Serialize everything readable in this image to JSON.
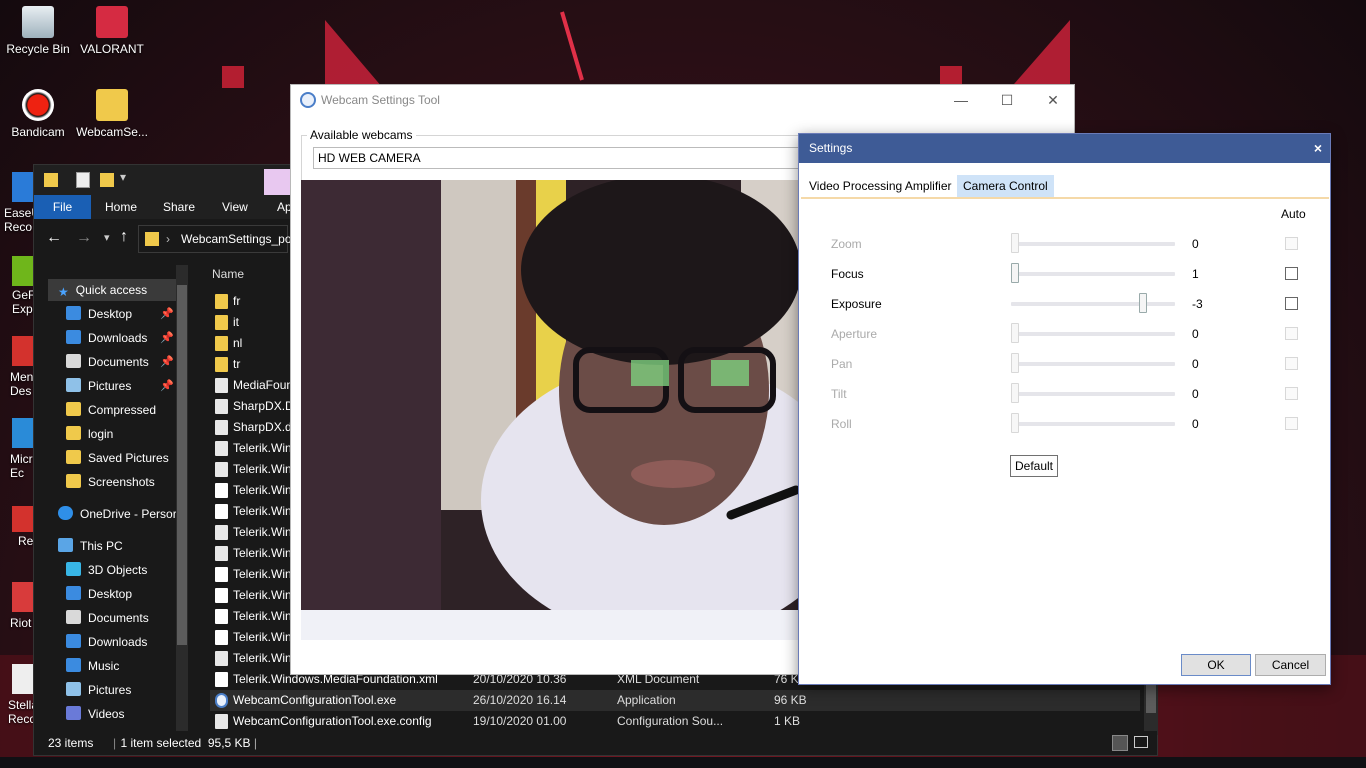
{
  "desktop": {
    "icons": [
      {
        "label": "Recycle Bin"
      },
      {
        "label": "VALORANT"
      },
      {
        "label": "Bandicam"
      },
      {
        "label": "WebcamSe..."
      },
      {
        "label": "EaseU\nReco"
      },
      {
        "label": "GeF\nExpe"
      },
      {
        "label": "Men\nDes"
      },
      {
        "label": "Micr\nEc"
      },
      {
        "label": "Rec"
      },
      {
        "label": "Riot"
      },
      {
        "label": "Stella\nReco"
      }
    ]
  },
  "explorer": {
    "ribbon_tabs": [
      "File",
      "Home",
      "Share",
      "View",
      "Ap"
    ],
    "address": "WebcamSettings_por",
    "nav": {
      "quick_access": "Quick access",
      "quick_items": [
        "Desktop",
        "Downloads",
        "Documents",
        "Pictures",
        "Compressed",
        "login",
        "Saved Pictures",
        "Screenshots"
      ],
      "onedrive": "OneDrive - Persor",
      "this_pc": "This PC",
      "pc_items": [
        "3D Objects",
        "Desktop",
        "Documents",
        "Downloads",
        "Music",
        "Pictures",
        "Videos"
      ]
    },
    "column_name": "Name",
    "files": [
      {
        "name": "fr",
        "date": "",
        "type": "",
        "size": "",
        "kind": "folder"
      },
      {
        "name": "it",
        "date": "",
        "type": "",
        "size": "",
        "kind": "folder"
      },
      {
        "name": "nl",
        "date": "",
        "type": "",
        "size": "",
        "kind": "folder"
      },
      {
        "name": "tr",
        "date": "",
        "type": "",
        "size": "",
        "kind": "folder"
      },
      {
        "name": "MediaFoun",
        "date": "",
        "type": "",
        "size": "",
        "kind": "dll"
      },
      {
        "name": "SharpDX.Di",
        "date": "",
        "type": "",
        "size": "",
        "kind": "dll"
      },
      {
        "name": "SharpDX.dl",
        "date": "",
        "type": "",
        "size": "",
        "kind": "dll"
      },
      {
        "name": "Telerik.Wind",
        "date": "",
        "type": "",
        "size": "",
        "kind": "dll"
      },
      {
        "name": "Telerik.Wind",
        "date": "",
        "type": "",
        "size": "",
        "kind": "dll"
      },
      {
        "name": "Telerik.Wind",
        "date": "",
        "type": "",
        "size": "",
        "kind": "doc"
      },
      {
        "name": "Telerik.Wind",
        "date": "",
        "type": "",
        "size": "",
        "kind": "doc"
      },
      {
        "name": "Telerik.Wind",
        "date": "",
        "type": "",
        "size": "",
        "kind": "dll"
      },
      {
        "name": "Telerik.Wind",
        "date": "",
        "type": "",
        "size": "",
        "kind": "dll"
      },
      {
        "name": "Telerik.Wind",
        "date": "",
        "type": "",
        "size": "",
        "kind": "doc"
      },
      {
        "name": "Telerik.Wind",
        "date": "",
        "type": "",
        "size": "",
        "kind": "doc"
      },
      {
        "name": "Telerik.Wind",
        "date": "",
        "type": "",
        "size": "",
        "kind": "doc"
      },
      {
        "name": "Telerik.Wind",
        "date": "",
        "type": "",
        "size": "",
        "kind": "doc"
      },
      {
        "name": "Telerik.Wind",
        "date": "",
        "type": "",
        "size": "",
        "kind": "dll"
      },
      {
        "name": "Telerik.Windows.MediaFoundation.xml",
        "date": "20/10/2020 10.36",
        "type": "XML Document",
        "size": "76 KB",
        "kind": "doc"
      },
      {
        "name": "WebcamConfigurationTool.exe",
        "date": "26/10/2020 16.14",
        "type": "Application",
        "size": "96 KB",
        "kind": "exe"
      },
      {
        "name": "WebcamConfigurationTool.exe.config",
        "date": "19/10/2020 01.00",
        "type": "Configuration Sou...",
        "size": "1 KB",
        "kind": "cfg"
      }
    ],
    "selected_file": "WebcamConfigurationTool.exe",
    "status_items": "23 items",
    "status_selected": "1 item selected  95,5 KB"
  },
  "webcam_tool": {
    "title": "Webcam Settings Tool",
    "group_label": "Available webcams",
    "selected_webcam": "HD WEB CAMERA"
  },
  "settings": {
    "title": "Settings",
    "tabs": [
      "Video Processing Amplifier",
      "Camera Control"
    ],
    "active_tab": "Camera Control",
    "auto_header": "Auto",
    "controls": [
      {
        "label": "Zoom",
        "value": "0",
        "level": 0.0,
        "enabled": false
      },
      {
        "label": "Focus",
        "value": "1",
        "level": 0.0,
        "enabled": true
      },
      {
        "label": "Exposure",
        "value": "-3",
        "level": 0.82,
        "enabled": true
      },
      {
        "label": "Aperture",
        "value": "0",
        "level": 0.0,
        "enabled": false
      },
      {
        "label": "Pan",
        "value": "0",
        "level": 0.0,
        "enabled": false
      },
      {
        "label": "Tilt",
        "value": "0",
        "level": 0.0,
        "enabled": false
      },
      {
        "label": "Roll",
        "value": "0",
        "level": 0.0,
        "enabled": false
      }
    ],
    "default_label": "Default",
    "ok_label": "OK",
    "cancel_label": "Cancel"
  },
  "colors": {
    "accent_blue": "#3e5b96",
    "explorer_bg": "#191919",
    "tab_active": "#cfe3f8"
  }
}
